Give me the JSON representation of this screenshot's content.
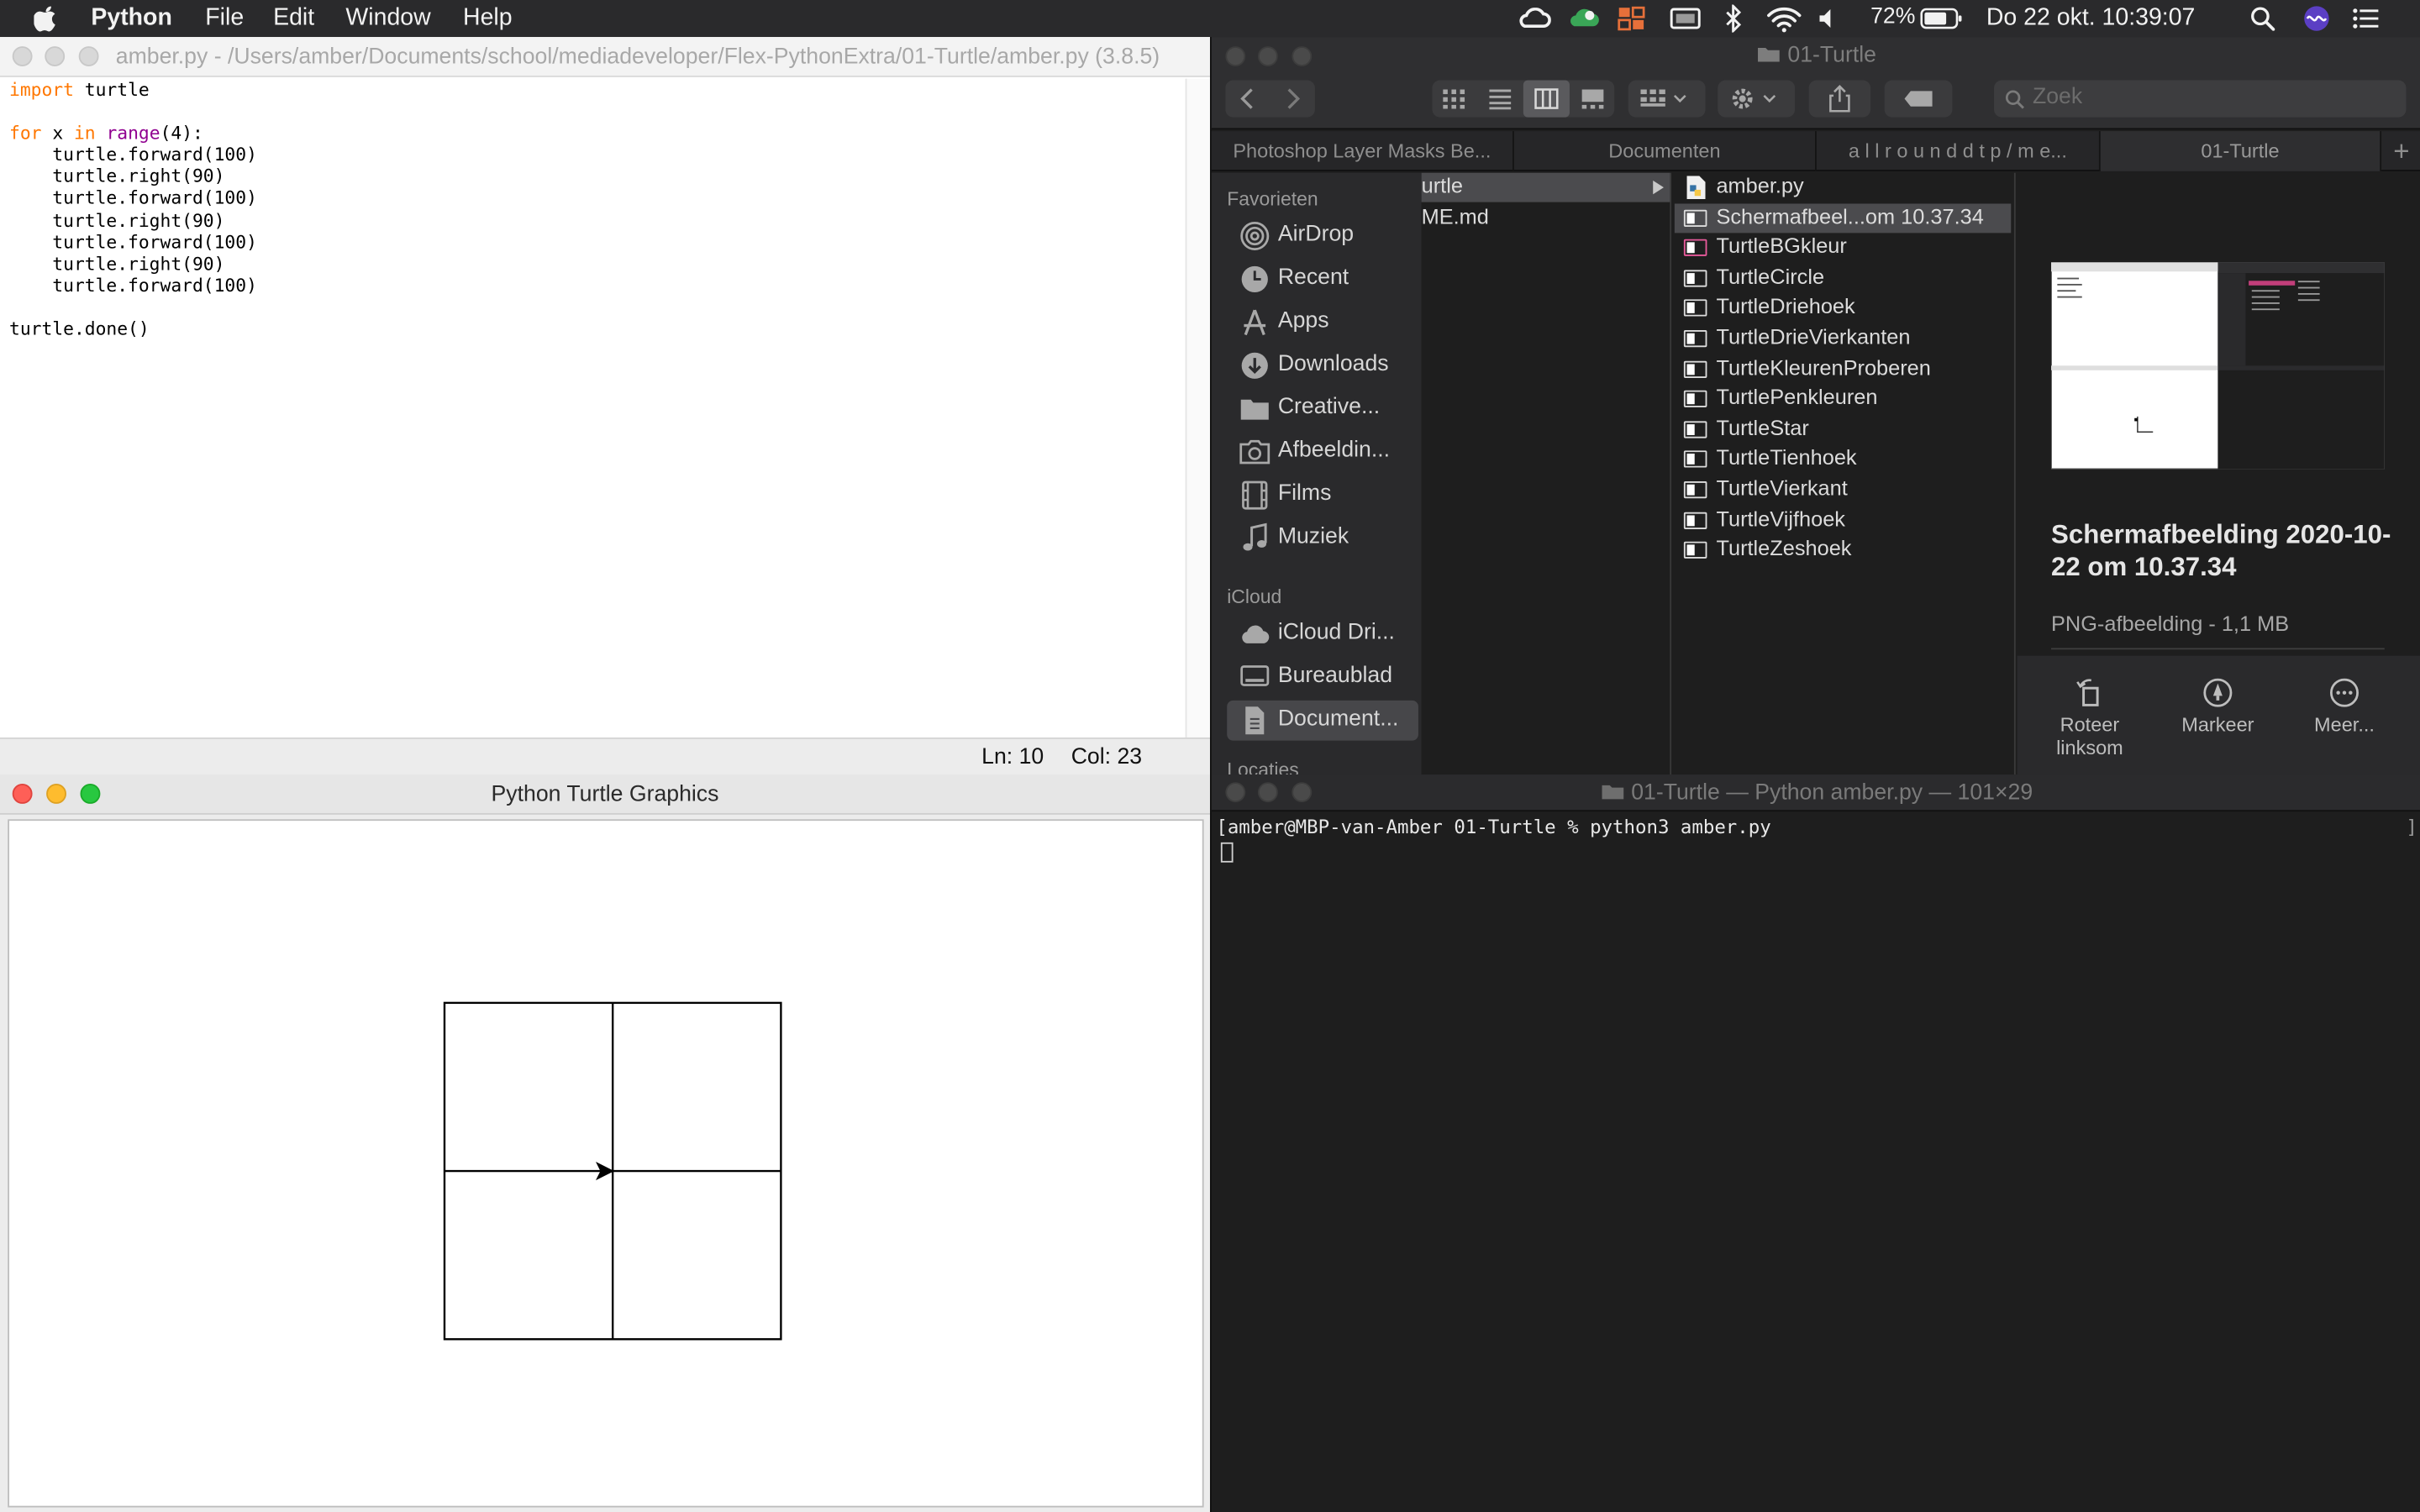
{
  "menubar": {
    "app": "Python",
    "items": [
      "File",
      "Edit",
      "Window",
      "Help"
    ],
    "battery": "72%",
    "datetime": "Do 22 okt.  10:39:07"
  },
  "editor": {
    "title": "amber.py - /Users/amber/Documents/school/mediadeveloper/Flex-PythonExtra/01-Turtle/amber.py (3.8.5)",
    "status_line": "Ln: 10",
    "status_col": "Col: 23"
  },
  "turtle_window": {
    "title": "Python Turtle Graphics"
  },
  "finder": {
    "title": "01-Turtle",
    "search_placeholder": "Zoek",
    "tabs": [
      "Photoshop Layer Masks Be...",
      "Documenten",
      "a l l r o u n d  d t p / m e...",
      "01-Turtle"
    ],
    "sidebar": {
      "favorites_heading": "Favorieten",
      "favorites": [
        "AirDrop",
        "Recent",
        "Apps",
        "Downloads",
        "Creative...",
        "Afbeeldin...",
        "Films",
        "Muziek"
      ],
      "icloud_heading": "iCloud",
      "icloud": [
        "iCloud Dri...",
        "Bureaublad",
        "Document..."
      ],
      "locations_heading": "Locaties"
    },
    "column1": [
      "urtle",
      "ME.md"
    ],
    "column2": [
      "amber.py",
      "Schermafbeel...om 10.37.34",
      "TurtleBGkleur",
      "TurtleCircle",
      "TurtleDriehoek",
      "TurtleDrieVierkanten",
      "TurtleKleurenProberen",
      "TurtlePenkleuren",
      "TurtleStar",
      "TurtleTienhoek",
      "TurtleVierkant",
      "TurtleVijfhoek",
      "TurtleZeshoek"
    ],
    "preview": {
      "name": "Schermafbeelding 2020-10-22 om 10.37.34",
      "kind": "PNG-afbeelding - 1,1 MB",
      "actions": [
        "Roteer linksom",
        "Markeer",
        "Meer..."
      ]
    }
  },
  "terminal": {
    "title": "01-Turtle — Python amber.py — 101×29",
    "prompt_line": "[amber@MBP-van-Amber 01-Turtle % python3 amber.py"
  }
}
